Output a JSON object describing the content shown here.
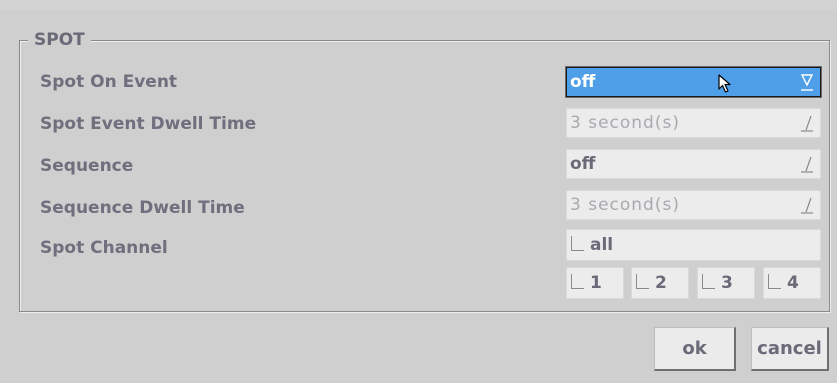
{
  "group": {
    "title": "SPOT"
  },
  "rows": [
    {
      "label": "Spot On Event",
      "value": "off",
      "state": "selected"
    },
    {
      "label": "Spot Event Dwell Time",
      "value": "3 second(s)",
      "state": "disabled"
    },
    {
      "label": "Sequence",
      "value": "off",
      "state": "normal"
    },
    {
      "label": "Sequence Dwell Time",
      "value": "3 second(s)",
      "state": "disabled"
    }
  ],
  "spot_channel": {
    "label": "Spot Channel",
    "all_label": "all",
    "channels": [
      "1",
      "2",
      "3",
      "4"
    ]
  },
  "buttons": {
    "ok": "ok",
    "cancel": "cancel"
  },
  "colors": {
    "background": "#cfcfcf",
    "field": "#ececec",
    "selected": "#4f9ee8",
    "text": "#6a6a78",
    "disabled_text": "#a9a9b0"
  },
  "icons": {
    "dropdown_selected": "dropdown-hourglass-icon",
    "dropdown_normal": "dropdown-slash-icon",
    "cursor": "mouse-cursor-icon",
    "checkbox": "checkbox-icon"
  }
}
